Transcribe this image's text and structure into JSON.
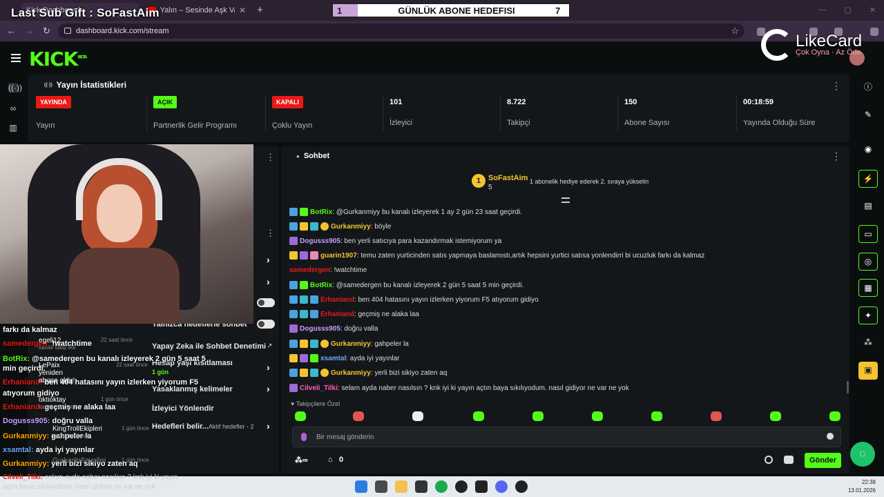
{
  "overlay": {
    "subgift": "Last Sub Gift : SoFastAim",
    "goal_left": "1",
    "goal_title": "GÜNLÜK ABONE HEDEFISI",
    "goal_right": "7",
    "likecard_name": "LikeCard",
    "likecard_slogan": "Çok Oyna · Az Öde"
  },
  "browser": {
    "tabs": [
      {
        "label": "Kick Dashboard"
      },
      {
        "label": "Yalın – Sesinde Aşk Var (Offici..."
      }
    ],
    "url": "dashboard.kick.com/stream"
  },
  "stats": {
    "title": "Yayın İstatistikleri",
    "cells": [
      {
        "badge": "YAYINDA",
        "label": "Yayın"
      },
      {
        "badge": "AÇIK",
        "label": "Partnerlik Gelir Programı"
      },
      {
        "badge": "KAPALI",
        "label": "Çoklu Yayın"
      },
      {
        "value": "101",
        "label": "İzleyici"
      },
      {
        "value": "8.722",
        "label": "Takipçi"
      },
      {
        "value": "150",
        "label": "Abone Sayısı"
      },
      {
        "value": "00:18:59",
        "label": "Yayında Olduğu Süre"
      }
    ]
  },
  "leftpanel": {
    "rows": [
      {
        "label": "Yalnızca hedeflerle sohbet"
      },
      {
        "label": "Yapay Zeka ile Sohbet Denetimi"
      },
      {
        "label": "Hesap yaşı kısıtlaması"
      },
      {
        "label": "1 gün"
      },
      {
        "label": "Yasaklanmış kelimeler"
      },
      {
        "label": "İzleyici Yönlendir"
      },
      {
        "label": "Hedefleri belir..."
      },
      {
        "label": "Aktif hedefler - 2"
      }
    ]
  },
  "overlay_chat": [
    {
      "user": "",
      "text": "farkı da kalmaz"
    },
    {
      "user": "samedergen:",
      "text": " !watchtime"
    },
    {
      "user": "BotRix:",
      "text": " @samedergen bu kanalı izleyerek 2 gün 5 saat 5"
    },
    {
      "user": "",
      "text": "min geçirdi."
    },
    {
      "user": "Erhaniand:",
      "text": " ben 404 hatasını yayın izlerken yiyorum F5"
    },
    {
      "user": "",
      "text": "atıyorum gidiyo"
    },
    {
      "user": "Erhaniand:",
      "text": " geçmiş ne alaka laa"
    },
    {
      "user": "Dogusss905:",
      "text": " doğru valla"
    },
    {
      "user": "Gurkanmiyy:",
      "text": " gahpeler la"
    },
    {
      "user": "xsamtal:",
      "text": " ayda iyi yayınlar"
    },
    {
      "user": "Gurkanmiyy:",
      "text": " yerli bizi sikiyo zaten aq"
    }
  ],
  "events": [
    {
      "name": "egeli12",
      "sub": "kanalı takip etti",
      "time": "22 saat önce"
    },
    {
      "name": "LePaix yeniden abone oldu!",
      "sub": "",
      "time": "22 saat önce"
    },
    {
      "name": "oktioktay",
      "sub": "kanalı takip etti",
      "time": "1 gün önce"
    },
    {
      "name": "KingTrollEkipleri",
      "sub": "kanalı takip etti",
      "time": "1 gün önce"
    },
    {
      "name": "GurkanlnSevgilisi",
      "sub": "",
      "time": "1 gün önce"
    }
  ],
  "chat": {
    "title": "Sohbet",
    "pinned_user": "SoFastAim",
    "pinned_rank": "1",
    "pinned_count": "5",
    "pinned_cta": "1 abonelik hediye ederek 2. sıraya yükselin",
    "messages": [
      {
        "name": "BotRix",
        "text": ": @Gurkanmiyy bu kanalı izleyerek 1 ay 2 gün 23 saat geçirdi.",
        "color": "g"
      },
      {
        "name": "Gurkanmiyy",
        "text": ": böyle",
        "color": "o"
      },
      {
        "name": "Dogusss905",
        "text": ": ben yerli satıcıya para kazandırmak istemiyorum ya",
        "color": "p"
      },
      {
        "name": "guarin1907",
        "text": ": temu zaten yurticinden satıs yapmaya baslamıstı,artık hepsini yurtici satısa yonlendirri bi ucuzluk farkı da kalmaz",
        "color": "o"
      },
      {
        "name": "samedergen",
        "text": ": !watchtime",
        "color": "r"
      },
      {
        "name": "BotRix",
        "text": ": @samedergen bu kanalı izleyerek 2 gün 5 saat 5 min geçirdi.",
        "color": "g"
      },
      {
        "name": "Erhaniand",
        "text": ": ben 404 hatasını yayın izlerken yiyorum F5 atıyorum gidiyo",
        "color": "r"
      },
      {
        "name": "Erhaniand",
        "text": ": geçmiş ne alaka laa",
        "color": "r"
      },
      {
        "name": "Dogusss905",
        "text": ": doğru valla",
        "color": "p"
      },
      {
        "name": "Gurkanmiyy",
        "text": ": gahpeler la",
        "color": "o"
      },
      {
        "name": "xsamtal",
        "text": ": ayda iyi yayınlar",
        "color": "b"
      },
      {
        "name": "Gurkanmiyy",
        "text": ": yerli bizi sikiyo zaten aq",
        "color": "o"
      },
      {
        "name": "Cilveli_Tilki",
        "text": ": selam ayda naber nasılsın ? knk iyi ki yayın açtın baya sıkılıyodum. nasıl gidiyor ne var ne yok",
        "color": "m"
      }
    ],
    "subs_only": "Takipçilere Özel",
    "placeholder": "Bir mesaj gönderin",
    "count": "0",
    "send": "Gönder"
  },
  "ticker": [
    {
      "user": "Cilveli_Tilki:",
      "text": " selam ayda naber nasılsın ? knk iyi ki yayın"
    },
    {
      "user": "",
      "text": "açtın baya sıkılıyodum. nasıl gidiyor ne var ne yok"
    }
  ],
  "taskbar": {
    "time": "22:38",
    "date": "13.01.2026"
  }
}
